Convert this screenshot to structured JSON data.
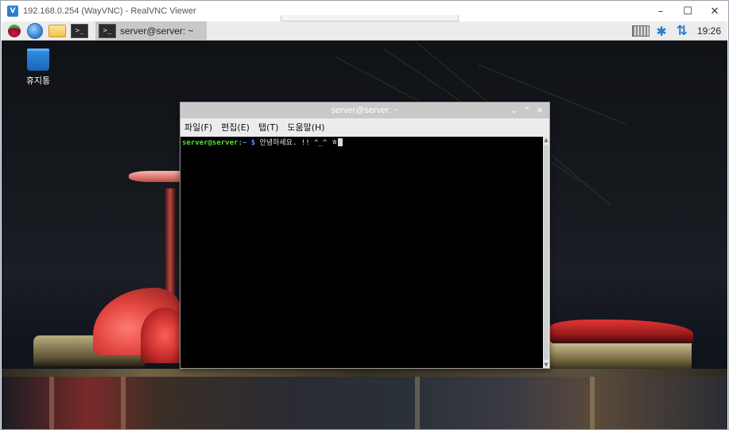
{
  "vnc": {
    "title": "192.168.0.254 (WayVNC) - RealVNC Viewer",
    "app_icon": "realvnc-icon",
    "controls": {
      "minimize": "–",
      "maximize": "☐",
      "close": "✕"
    }
  },
  "panel": {
    "launchers": [
      "raspberry-menu-icon",
      "web-browser-icon",
      "file-manager-icon",
      "terminal-icon"
    ],
    "terminal_glyph": ">_",
    "task": {
      "label": "server@server: ~"
    },
    "tray": {
      "keyboard": "keyboard-icon",
      "bluetooth": "bluetooth-icon",
      "network": "network-icon",
      "bluetooth_glyph": "✱",
      "network_glyph": "⇅"
    },
    "clock": "19:26"
  },
  "desktop": {
    "trash_label": "휴지통"
  },
  "terminal": {
    "title": "server@server: ~",
    "controls": {
      "minimize": "⌄",
      "maximize": "⌃",
      "close": "✕"
    },
    "menu": [
      "파일(F)",
      "편집(E)",
      "탭(T)",
      "도움말(H)"
    ],
    "prompt_user": "server@server",
    "prompt_sep": ":",
    "prompt_path": "~ $",
    "command": " 안녕하세요. !! ^_^ ㅎ"
  },
  "colors": {
    "prompt_user": "#5bdc3b",
    "prompt_path": "#5c8cff",
    "accent": "#1e7fd8"
  }
}
